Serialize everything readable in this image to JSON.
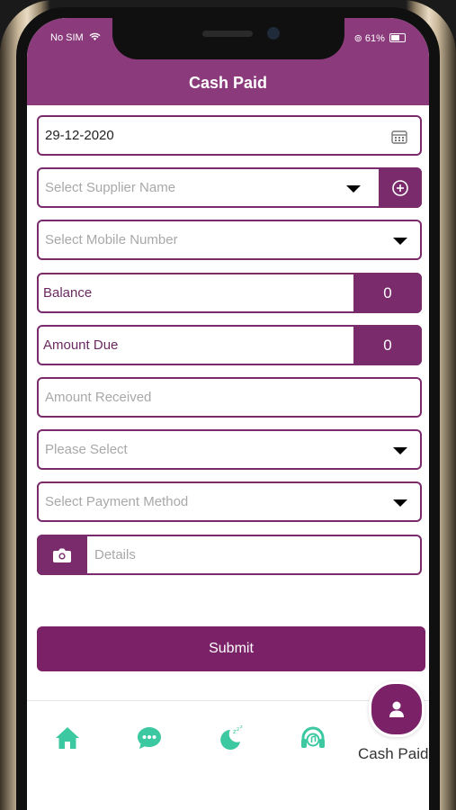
{
  "status_bar": {
    "carrier": "No SIM",
    "battery": "61%"
  },
  "header": {
    "title": "Cash Paid"
  },
  "form": {
    "date": "29-12-2020",
    "supplier_placeholder": "Select Supplier Name",
    "mobile_placeholder": "Select Mobile Number",
    "balance_label": "Balance",
    "balance_value": "0",
    "amount_due_label": "Amount Due",
    "amount_due_value": "0",
    "amount_received_placeholder": "Amount Received",
    "please_select_placeholder": "Please Select",
    "payment_method_placeholder": "Select Payment Method",
    "details_placeholder": "Details",
    "submit_label": "Submit"
  },
  "tabbar": {
    "items": [
      {
        "icon": "home-icon"
      },
      {
        "icon": "chat-icon"
      },
      {
        "icon": "sleep-icon"
      },
      {
        "icon": "headphones-icon"
      }
    ],
    "active_label": "Cash Paid"
  },
  "colors": {
    "primary": "#7a2168",
    "header": "#8b3b7b",
    "tab_icon": "#3cc8a0"
  }
}
